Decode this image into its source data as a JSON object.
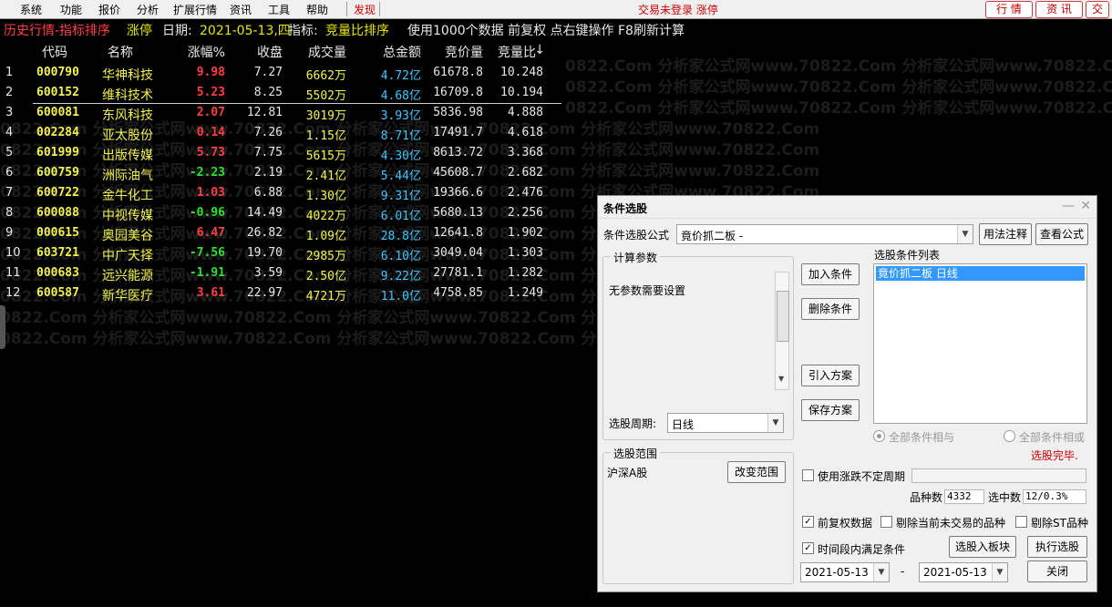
{
  "menu": {
    "items": [
      "系统",
      "功能",
      "报价",
      "分析",
      "扩展行情",
      "资讯",
      "工具",
      "帮助"
    ],
    "find": "发现",
    "status": "交易未登录  涨停",
    "right_buttons": [
      "行 情",
      "资 讯",
      "交"
    ]
  },
  "infobar": {
    "title": "历史行情-指标排序",
    "tag": "涨停",
    "date_label": "日期:",
    "date_value": "2021-05-13,四",
    "index_label": "指标:",
    "index_value": "竞量比排序",
    "desc": "使用1000个数据 前复权 点右键操作 F8刷新计算"
  },
  "watermark": "0822.Com    分析家公式网www.70822.Com    分析家公式网www.70822.Com    分析家公式网www.70822.Com",
  "table": {
    "headers": [
      "代码",
      "名称",
      "涨幅%",
      "收盘",
      "成交量",
      "总金额",
      "竞价量",
      "竞量比"
    ],
    "sort_mark": "↓",
    "rows": [
      {
        "rank": "1",
        "code": "000790",
        "name": "华神科技",
        "chg": "9.98",
        "dir": "up",
        "close": "7.27",
        "vol": "6662万",
        "amt": "4.72亿",
        "bid": "61678.8",
        "ratio": "10.248"
      },
      {
        "rank": "2",
        "code": "600152",
        "name": "维科技术",
        "chg": "5.23",
        "dir": "up",
        "close": "8.25",
        "vol": "5502万",
        "amt": "4.68亿",
        "bid": "16709.8",
        "ratio": "10.194"
      },
      {
        "rank": "3",
        "code": "600081",
        "name": "东风科技",
        "chg": "2.07",
        "dir": "up",
        "close": "12.81",
        "vol": "3019万",
        "amt": "3.93亿",
        "bid": "5836.98",
        "ratio": "4.888"
      },
      {
        "rank": "4",
        "code": "002284",
        "name": "亚太股份",
        "chg": "0.14",
        "dir": "up",
        "close": "7.26",
        "vol": "1.15亿",
        "amt": "8.71亿",
        "bid": "17491.7",
        "ratio": "4.618"
      },
      {
        "rank": "5",
        "code": "601999",
        "name": "出版传媒",
        "chg": "5.73",
        "dir": "up",
        "close": "7.75",
        "vol": "5615万",
        "amt": "4.30亿",
        "bid": "8613.72",
        "ratio": "3.368"
      },
      {
        "rank": "6",
        "code": "600759",
        "name": "洲际油气",
        "chg": "-2.23",
        "dir": "down",
        "close": "2.19",
        "vol": "2.41亿",
        "amt": "5.44亿",
        "bid": "45608.7",
        "ratio": "2.682"
      },
      {
        "rank": "7",
        "code": "600722",
        "name": "金牛化工",
        "chg": "1.03",
        "dir": "up",
        "close": "6.88",
        "vol": "1.30亿",
        "amt": "9.31亿",
        "bid": "19366.6",
        "ratio": "2.476"
      },
      {
        "rank": "8",
        "code": "600088",
        "name": "中视传媒",
        "chg": "-0.96",
        "dir": "down",
        "close": "14.49",
        "vol": "4022万",
        "amt": "6.01亿",
        "bid": "5680.13",
        "ratio": "2.256"
      },
      {
        "rank": "9",
        "code": "000615",
        "name": "奥园美谷",
        "chg": "6.47",
        "dir": "up",
        "close": "26.82",
        "vol": "1.09亿",
        "amt": "28.8亿",
        "bid": "12641.8",
        "ratio": "1.902"
      },
      {
        "rank": "10",
        "code": "603721",
        "name": "中广天择",
        "chg": "-7.56",
        "dir": "down",
        "close": "19.70",
        "vol": "2985万",
        "amt": "6.10亿",
        "bid": "3049.04",
        "ratio": "1.303"
      },
      {
        "rank": "11",
        "code": "000683",
        "name": "远兴能源",
        "chg": "-1.91",
        "dir": "down",
        "close": "3.59",
        "vol": "2.50亿",
        "amt": "9.22亿",
        "bid": "27781.1",
        "ratio": "1.282"
      },
      {
        "rank": "12",
        "code": "600587",
        "name": "新华医疗",
        "chg": "3.61",
        "dir": "up",
        "close": "22.97",
        "vol": "4721万",
        "amt": "11.0亿",
        "bid": "4758.85",
        "ratio": "1.249"
      }
    ]
  },
  "dialog": {
    "title": "条件选股",
    "formula_label": "条件选股公式",
    "formula_value": "竟价抓二板    -",
    "usage_btn": "用法注释",
    "view_btn": "查看公式",
    "params_group": "计算参数",
    "params_text": "无参数需要设置",
    "period_label": "选股周期:",
    "period_value": "日线",
    "add_btn": "加入条件",
    "del_btn": "删除条件",
    "import_btn": "引入方案",
    "save_btn": "保存方案",
    "list_label": "选股条件列表",
    "list_item": "竟价抓二板   日线",
    "radio_and": "全部条件相与",
    "radio_or": "全部条件相或",
    "done": "选股完毕.",
    "scope_group": "选股范围",
    "scope_value": "沪深A股",
    "scope_btn": "改变范围",
    "use_range_label": "使用涨跌不定周期",
    "count_label": "品种数",
    "count_value": "4332",
    "hit_label": "选中数",
    "hit_value": "12/0.3%",
    "adj_label": "前复权数据",
    "excl_untraded": "剔除当前未交易的品种",
    "excl_st": "剔除ST品种",
    "period_satisfy": "时间段内满足条件",
    "to_block_btn": "选股入板块",
    "run_btn": "执行选股",
    "date_from": "2021-05-13",
    "date_sep": "-",
    "date_to": "2021-05-13",
    "close_btn": "关闭"
  }
}
